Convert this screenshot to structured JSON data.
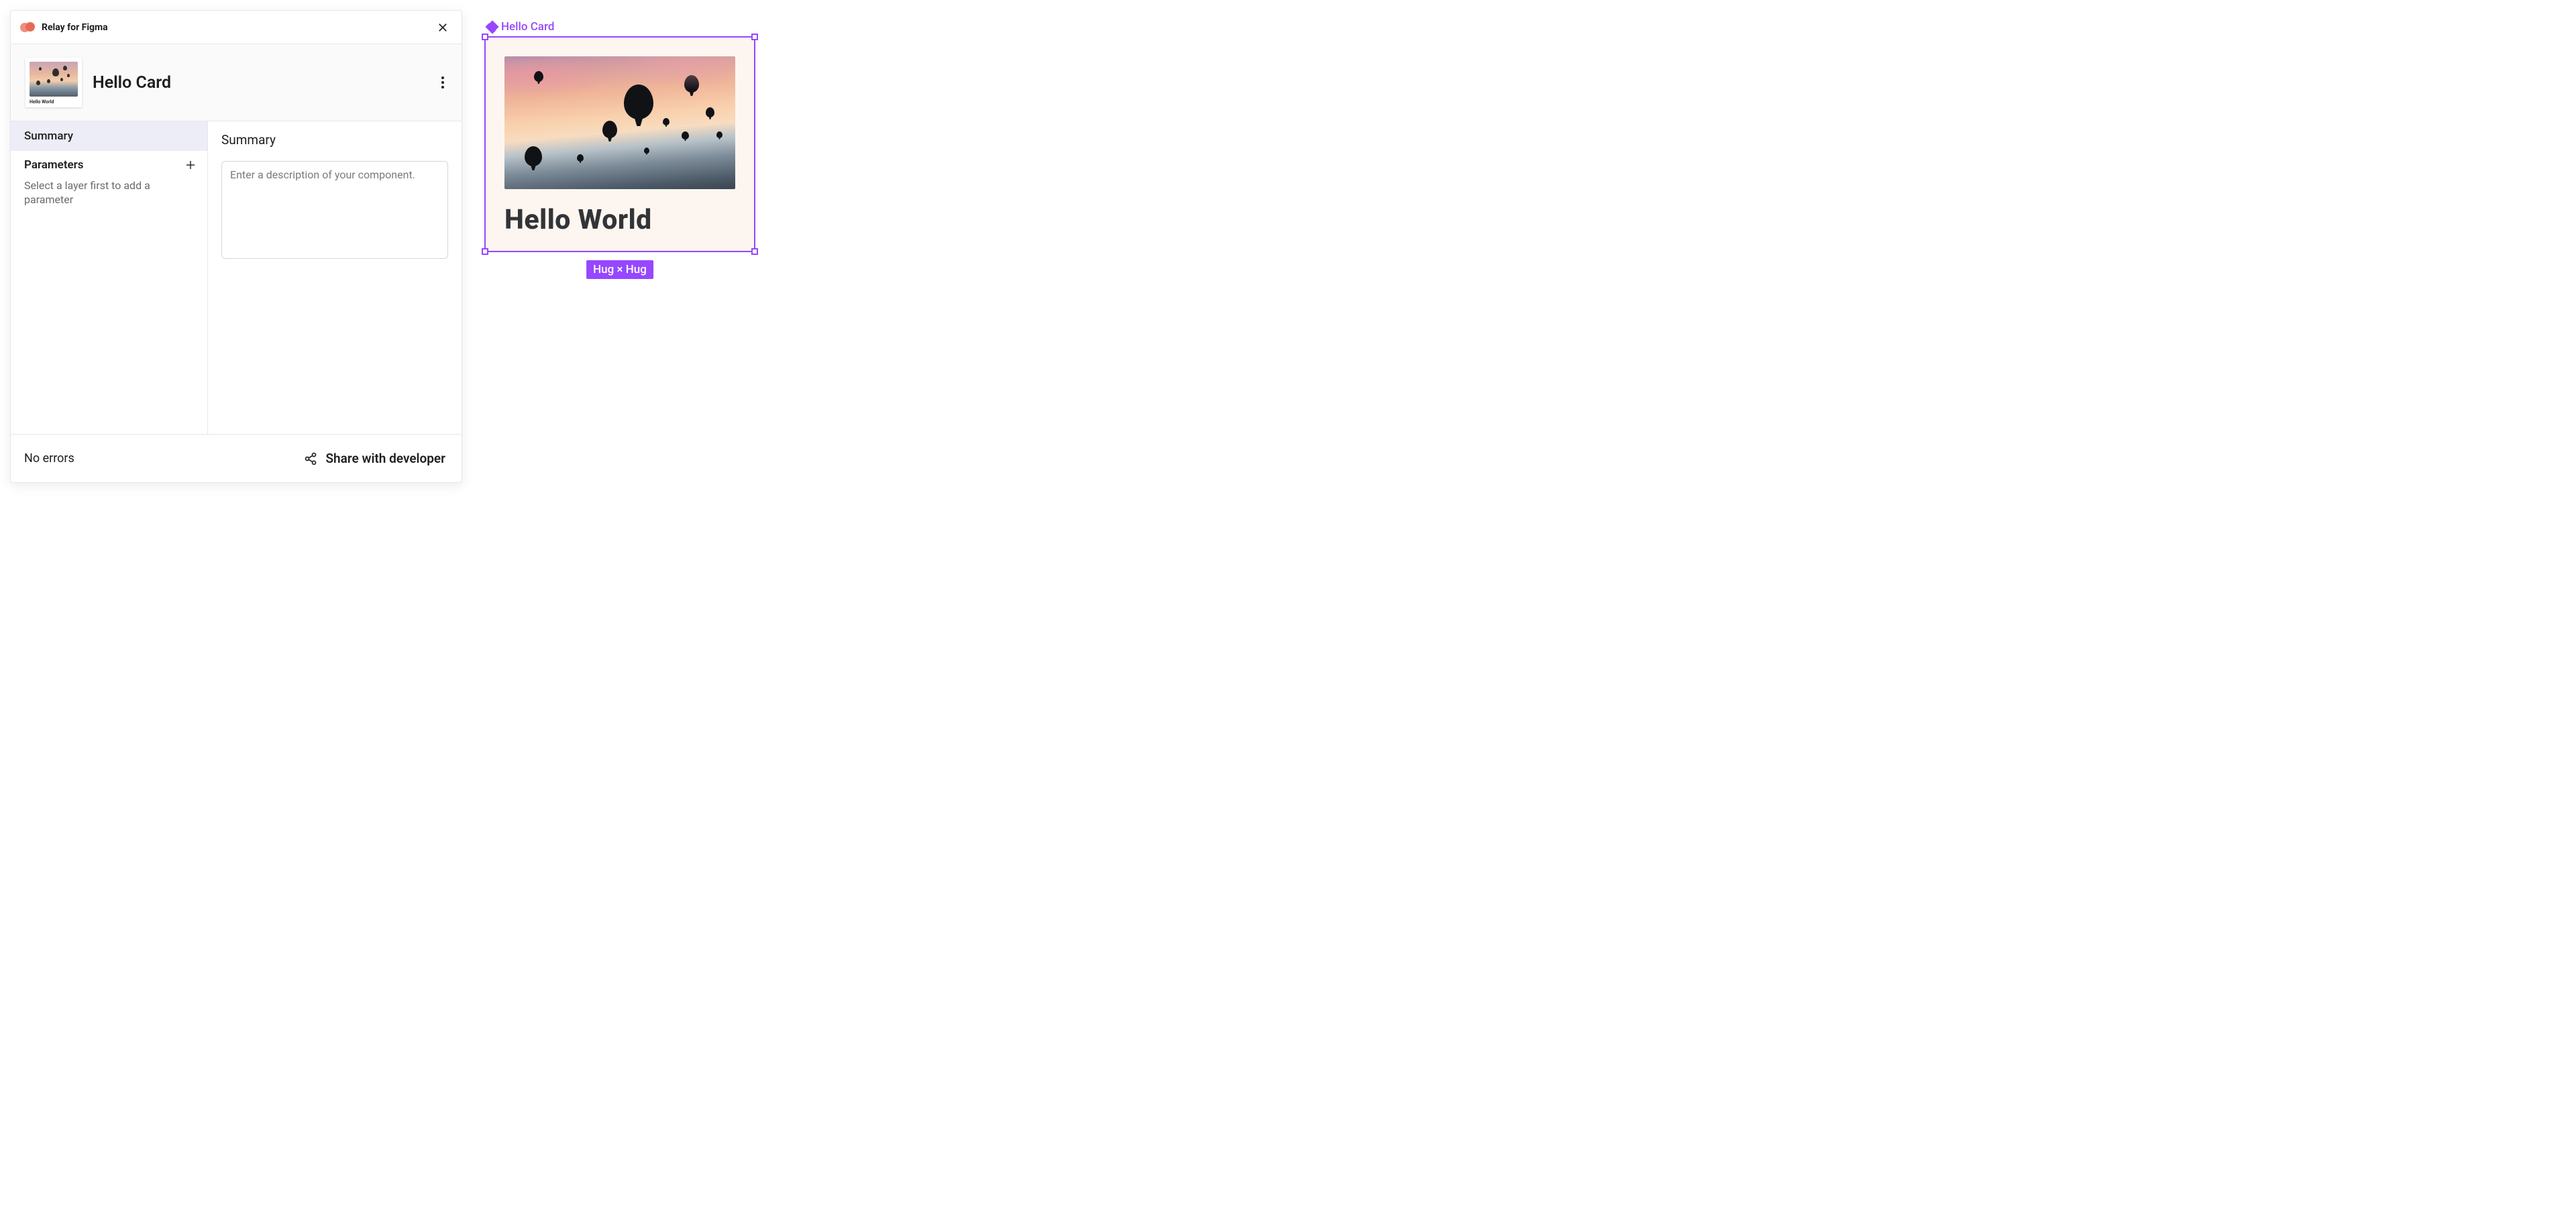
{
  "plugin": {
    "title": "Relay for Figma",
    "component_name": "Hello Card",
    "thumbnail_text": "Hello World"
  },
  "sidebar": {
    "tab_summary": "Summary",
    "parameters_title": "Parameters",
    "parameters_hint": "Select a layer first to add a parameter"
  },
  "main": {
    "heading": "Summary",
    "desc_placeholder": "Enter a description of your component."
  },
  "footer": {
    "status": "No errors",
    "share_label": "Share with developer"
  },
  "canvas": {
    "frame_name": "Hello Card",
    "card_title": "Hello World",
    "constraint_label": "Hug × Hug"
  },
  "colors": {
    "selection": "#9647ff",
    "card_bg": "#fdf6f0"
  }
}
